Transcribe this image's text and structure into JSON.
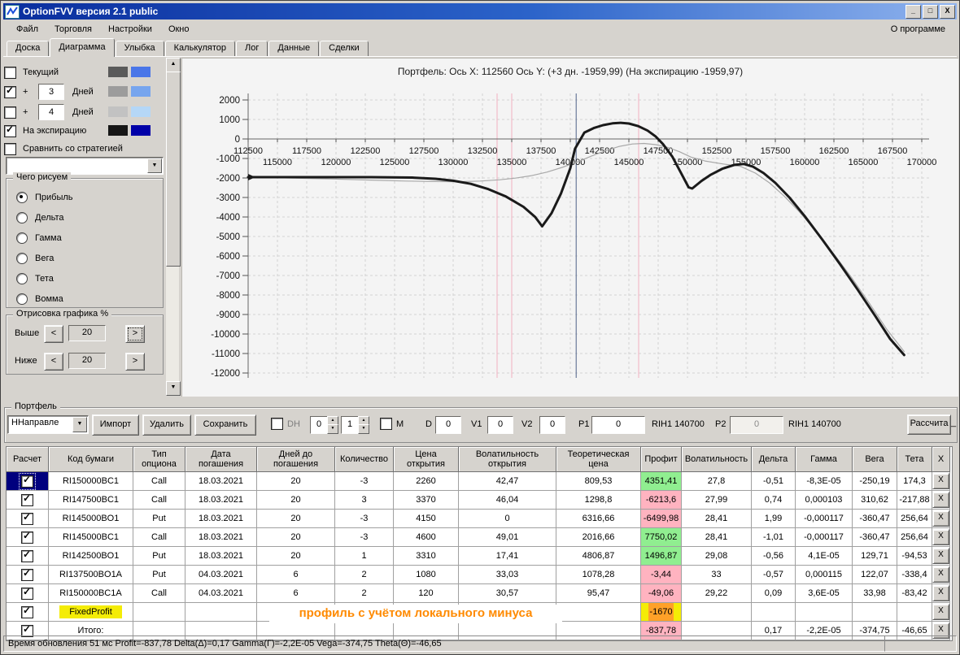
{
  "window": {
    "title": "OptionFVV версия 2.1 public",
    "controls": [
      "_",
      "□",
      "X"
    ]
  },
  "menu": {
    "items": [
      "Файл",
      "Торговля",
      "Настройки",
      "Окно"
    ],
    "right": "О программе"
  },
  "tabs": {
    "items": [
      "Доска",
      "Диаграмма",
      "Улыбка",
      "Калькулятор",
      "Лог",
      "Данные",
      "Сделки"
    ],
    "active": "Диаграмма"
  },
  "left_panel": {
    "series_toggles": [
      {
        "checked": false,
        "label": "Текущий",
        "value": null,
        "suffix": null,
        "swatch1": "#5a5a5a",
        "swatch2": "#4a76e8"
      },
      {
        "checked": true,
        "label": "+",
        "value": "3",
        "suffix": "Дней",
        "swatch1": "#9c9c9c",
        "swatch2": "#77a5ee"
      },
      {
        "checked": false,
        "label": "+",
        "value": "4",
        "suffix": "Дней",
        "swatch1": "#c2c2c2",
        "swatch2": "#b5d7f7"
      },
      {
        "checked": true,
        "label": "На экспирацию",
        "value": null,
        "suffix": null,
        "swatch1": "#161616",
        "swatch2": "#0000a8"
      },
      {
        "checked": false,
        "label": "Сравнить со стратегией",
        "value": null,
        "suffix": null,
        "swatch1": null,
        "swatch2": null
      }
    ],
    "strategy_combo_value": "",
    "draw_group": {
      "title": "Чего рисуем",
      "options": [
        "Прибыль",
        "Дельта",
        "Гамма",
        "Вега",
        "Тета",
        "Вомма"
      ],
      "selected": "Прибыль"
    },
    "range_group": {
      "title": "Отрисовка графика %",
      "rows": [
        {
          "label": "Выше",
          "left": "<",
          "value": "20",
          "right": ">"
        },
        {
          "label": "Ниже",
          "left": "<",
          "value": "20",
          "right": ">"
        }
      ]
    }
  },
  "chart_data": {
    "type": "line",
    "title": "Портфель: Ось X: 112560 Ось Y:  (+3 дн. -1959,99)  (На экспирацию -1959,97)",
    "x_axis": {
      "min": 112500,
      "max": 170600,
      "tick_step": 2500,
      "labels_row1": [
        112500,
        117500,
        122500,
        127500,
        132500,
        137500,
        142500,
        147500,
        152500,
        157500,
        162500,
        167500
      ],
      "labels_row2": [
        115000,
        120000,
        125000,
        130000,
        135000,
        140000,
        145000,
        150000,
        155000,
        160000,
        165000,
        170000
      ]
    },
    "y_axis": {
      "min": -12000,
      "max": 2000,
      "tick_step": 1000,
      "labels": [
        2000,
        1000,
        0,
        -1000,
        -2000,
        -3000,
        -4000,
        -5000,
        -6000,
        -7000,
        -8000,
        -9000,
        -10000,
        -11000,
        -12000
      ]
    },
    "grid": true,
    "vlines": [
      {
        "x": 133750,
        "color": "#f2b0c0",
        "name": "range-marker"
      },
      {
        "x": 135000,
        "color": "#f2b0c0",
        "name": "range-marker"
      },
      {
        "x": 145833,
        "color": "#f2b0c0",
        "name": "range-marker"
      },
      {
        "x": 140500,
        "color": "#4f6188",
        "name": "current-price-marker"
      }
    ],
    "series": [
      {
        "name": "На экспирацию",
        "color": "#1a1a1a",
        "width": 3,
        "points": [
          [
            112500,
            -1960
          ],
          [
            118000,
            -1960
          ],
          [
            123000,
            -1960
          ],
          [
            126500,
            -1980
          ],
          [
            128500,
            -2040
          ],
          [
            130000,
            -2140
          ],
          [
            131500,
            -2300
          ],
          [
            133000,
            -2570
          ],
          [
            134500,
            -2950
          ],
          [
            136000,
            -3480
          ],
          [
            137000,
            -4000
          ],
          [
            137600,
            -4480
          ],
          [
            138400,
            -3800
          ],
          [
            139200,
            -2800
          ],
          [
            140000,
            -1500
          ],
          [
            140400,
            -500
          ],
          [
            141200,
            330
          ],
          [
            142000,
            560
          ],
          [
            142800,
            710
          ],
          [
            143600,
            800
          ],
          [
            144300,
            830
          ],
          [
            145000,
            790
          ],
          [
            145800,
            660
          ],
          [
            146600,
            430
          ],
          [
            147300,
            120
          ],
          [
            147900,
            -260
          ],
          [
            148700,
            -900
          ],
          [
            149500,
            -1800
          ],
          [
            150100,
            -2480
          ],
          [
            150400,
            -2540
          ],
          [
            151200,
            -2150
          ],
          [
            152000,
            -1830
          ],
          [
            153000,
            -1520
          ],
          [
            154000,
            -1330
          ],
          [
            154800,
            -1280
          ],
          [
            155600,
            -1420
          ],
          [
            156500,
            -1750
          ],
          [
            157500,
            -2250
          ],
          [
            158700,
            -3000
          ],
          [
            160000,
            -3950
          ],
          [
            161500,
            -5150
          ],
          [
            163000,
            -6400
          ],
          [
            164500,
            -7700
          ],
          [
            166000,
            -9050
          ],
          [
            167300,
            -10250
          ],
          [
            168500,
            -11080
          ]
        ]
      },
      {
        "name": "+3 Дней",
        "color": "#a8a8a8",
        "width": 1.2,
        "points": [
          [
            112500,
            -1960
          ],
          [
            116000,
            -2000
          ],
          [
            119500,
            -2050
          ],
          [
            123000,
            -2110
          ],
          [
            126000,
            -2160
          ],
          [
            128500,
            -2185
          ],
          [
            130500,
            -2190
          ],
          [
            132300,
            -2160
          ],
          [
            134000,
            -2090
          ],
          [
            135300,
            -2010
          ],
          [
            136600,
            -1890
          ],
          [
            138000,
            -1700
          ],
          [
            139300,
            -1460
          ],
          [
            140600,
            -1180
          ],
          [
            141800,
            -880
          ],
          [
            143000,
            -600
          ],
          [
            144200,
            -380
          ],
          [
            145300,
            -260
          ],
          [
            146300,
            -230
          ],
          [
            147300,
            -290
          ],
          [
            148300,
            -430
          ],
          [
            149300,
            -650
          ],
          [
            150300,
            -930
          ],
          [
            151500,
            -1130
          ],
          [
            153000,
            -1280
          ],
          [
            154500,
            -1400
          ],
          [
            155800,
            -1750
          ],
          [
            157000,
            -2250
          ],
          [
            158200,
            -2900
          ],
          [
            159500,
            -3700
          ],
          [
            161000,
            -4750
          ],
          [
            162500,
            -5900
          ],
          [
            164000,
            -7100
          ],
          [
            165500,
            -8400
          ],
          [
            167000,
            -9750
          ],
          [
            168500,
            -10900
          ]
        ]
      }
    ]
  },
  "portfolio": {
    "legend": "Портфель",
    "combo_value": "ННаправле",
    "import_label": "Импорт",
    "delete_label": "Удалить",
    "save_label": "Сохранить",
    "dh_label": "DH",
    "dh_checked": false,
    "spin1": "0",
    "spin2": "1",
    "m_label": "M",
    "m_checked": false,
    "d_label": "D",
    "d_value": "0",
    "v1_label": "V1",
    "v1_value": "0",
    "v2_label": "V2",
    "v2_value": "0",
    "p1_label": "P1",
    "p1_value": "0",
    "p1_instrument": "RIH1 140700",
    "p2_label": "P2",
    "p2_value": "0",
    "p2_instrument": "RIH1 140700",
    "calc_label": "Рассчита",
    "after_calc": "_"
  },
  "table": {
    "headers": [
      "Расчет",
      "Код бумаги",
      "Тип\nопциона",
      "Дата\nпогашения",
      "Дней до\nпогашения",
      "Количество",
      "Цена\nоткрытия",
      "Волатильность\nоткрытия",
      "Теоретическая\nцена",
      "Профит",
      "Волатильность",
      "Дельта",
      "Гамма",
      "Вега",
      "Тета",
      "X"
    ],
    "delete_button": "X",
    "rows": [
      {
        "checked": true,
        "selected": true,
        "code_highlight": false,
        "profit_bg": "green",
        "cells": [
          "RI150000BC1",
          "Call",
          "18.03.2021",
          "20",
          "-3",
          "2260",
          "42,47",
          "809,53",
          "4351,41",
          "27,8",
          "-0,51",
          "-8,3E-05",
          "-250,19",
          "174,3"
        ]
      },
      {
        "checked": true,
        "selected": false,
        "code_highlight": false,
        "profit_bg": "pink",
        "cells": [
          "RI147500BC1",
          "Call",
          "18.03.2021",
          "20",
          "3",
          "3370",
          "46,04",
          "1298,8",
          "-6213,6",
          "27,99",
          "0,74",
          "0,000103",
          "310,62",
          "-217,88"
        ]
      },
      {
        "checked": true,
        "selected": false,
        "code_highlight": false,
        "profit_bg": "pink",
        "cells": [
          "RI145000BO1",
          "Put",
          "18.03.2021",
          "20",
          "-3",
          "4150",
          "0",
          "6316,66",
          "-6499,98",
          "28,41",
          "1,99",
          "-0,000117",
          "-360,47",
          "256,64"
        ]
      },
      {
        "checked": true,
        "selected": false,
        "code_highlight": false,
        "profit_bg": "green",
        "cells": [
          "RI145000BC1",
          "Call",
          "18.03.2021",
          "20",
          "-3",
          "4600",
          "49,01",
          "2016,66",
          "7750,02",
          "28,41",
          "-1,01",
          "-0,000117",
          "-360,47",
          "256,64"
        ]
      },
      {
        "checked": true,
        "selected": false,
        "code_highlight": false,
        "profit_bg": "green",
        "cells": [
          "RI142500BO1",
          "Put",
          "18.03.2021",
          "20",
          "1",
          "3310",
          "17,41",
          "4806,87",
          "1496,87",
          "29,08",
          "-0,56",
          "4,1E-05",
          "129,71",
          "-94,53"
        ]
      },
      {
        "checked": true,
        "selected": false,
        "code_highlight": false,
        "profit_bg": "pink",
        "cells": [
          "RI137500BO1A",
          "Put",
          "04.03.2021",
          "6",
          "2",
          "1080",
          "33,03",
          "1078,28",
          "-3,44",
          "33",
          "-0,57",
          "0,000115",
          "122,07",
          "-338,4"
        ]
      },
      {
        "checked": true,
        "selected": false,
        "code_highlight": false,
        "profit_bg": "pink",
        "cells": [
          "RI150000BC1A",
          "Call",
          "04.03.2021",
          "6",
          "2",
          "120",
          "30,57",
          "95,47",
          "-49,06",
          "29,22",
          "0,09",
          "3,6E-05",
          "33,98",
          "-83,42"
        ]
      },
      {
        "checked": true,
        "selected": false,
        "code_highlight": true,
        "profit_bg": "orange",
        "cells": [
          "FixedProfit",
          "",
          "",
          "",
          "",
          "",
          "",
          "",
          "-1670",
          "",
          "",
          "",
          "",
          ""
        ]
      },
      {
        "checked": true,
        "selected": false,
        "code_highlight": false,
        "profit_bg": "pink",
        "cells": [
          "Итого:",
          "",
          "",
          "",
          "",
          "",
          "",
          "",
          "-837,78",
          "",
          "0,17",
          "-2,2E-05",
          "-374,75",
          "-46,65"
        ]
      }
    ]
  },
  "annotation": {
    "text": "профиль с учётом локального минуса",
    "color": "#ff8a00"
  },
  "statusbar": {
    "text": "Время обновления 51 мс  Profit=-837,78 Delta(Δ)=0,17 Gamma(Г)=-2,2E-05 Vega=-374,75 Theta(Θ)=-46,65"
  }
}
